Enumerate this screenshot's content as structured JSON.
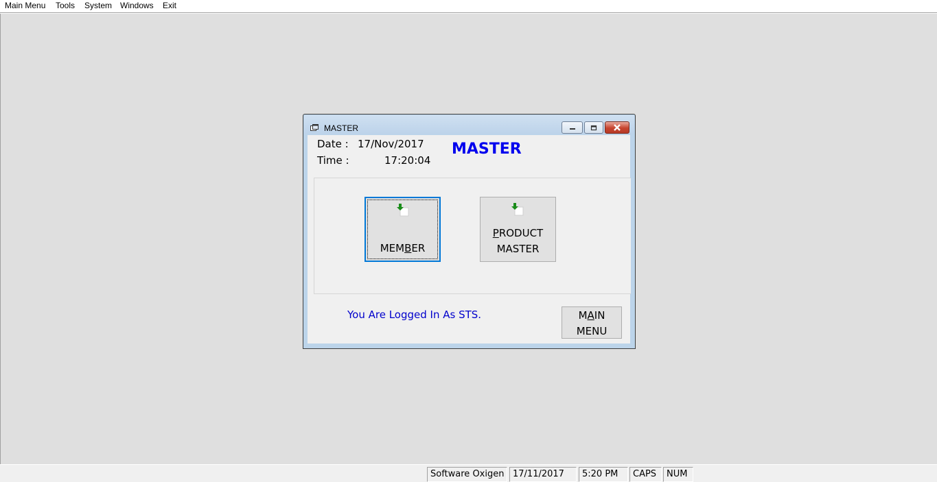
{
  "menubar": {
    "items": [
      "Main Menu",
      "Tools",
      "System",
      "Windows",
      "Exit"
    ]
  },
  "window": {
    "title": "MASTER",
    "date_label": "Date :",
    "date_value": "17/Nov/2017",
    "time_label": "Time :",
    "time_value": "17:20:04",
    "heading": "MASTER",
    "buttons": [
      {
        "label_lines": [
          "MEMBER"
        ],
        "icon": "download-arrow-icon",
        "focused": true,
        "mnemonic": "B"
      },
      {
        "label_lines": [
          "PRODUCT",
          "MASTER"
        ],
        "icon": "download-arrow-icon",
        "focused": false,
        "mnemonic": "P"
      }
    ],
    "logged_in_text": "You Are Logged In As STS.",
    "main_menu_button": {
      "line1": "MAIN",
      "line2": "MENU",
      "mnemonic": "A"
    }
  },
  "statusbar": {
    "company": "Software Oxigen",
    "date": "17/11/2017",
    "time": "5:20 PM",
    "caps": "CAPS",
    "num": "NUM"
  },
  "colors": {
    "heading": "#0000ee",
    "logged_text": "#0000cc",
    "focus_border": "#0078d7",
    "arrow": "#1a8c1a"
  }
}
